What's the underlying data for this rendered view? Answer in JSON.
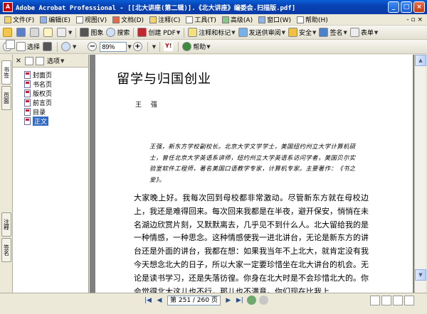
{
  "window": {
    "title": "Adobe Acrobat Professional - [[北大讲座(第二辑)].《北大讲座》编委会.扫描版.pdf]",
    "min": "_",
    "max": "□",
    "close": "×"
  },
  "menubar": {
    "items": [
      {
        "label": "文件(F)"
      },
      {
        "label": "编辑(E)"
      },
      {
        "label": "视图(V)"
      },
      {
        "label": "文档(D)"
      },
      {
        "label": "注释(C)"
      },
      {
        "label": "工具(T)"
      },
      {
        "label": "高级(A)"
      },
      {
        "label": "窗口(W)"
      },
      {
        "label": "帮助(H)"
      }
    ],
    "restore_label": "- ▫ ×"
  },
  "toolbar1": {
    "image_label": "图象",
    "search_label": "搜索",
    "create_pdf": "创建 PDF",
    "comment_markup": "注释和标记",
    "send_review": "发送供审阅",
    "security": "安全",
    "sign": "签名",
    "forms": "表单"
  },
  "toolbar2": {
    "select_label": "选择",
    "zoom_value": "89%",
    "help_label": "帮助",
    "yahoo": "Y!"
  },
  "sidebar_tabs": {
    "tab1": "书签",
    "tab2": "页面",
    "tab3": "注释",
    "tab4": "签名"
  },
  "bookmarks": {
    "options_label": "选项",
    "items": [
      {
        "label": "封面页"
      },
      {
        "label": "书名页"
      },
      {
        "label": "版权页"
      },
      {
        "label": "前言页"
      },
      {
        "label": "目录"
      },
      {
        "label": "正文"
      }
    ],
    "selected_index": 5
  },
  "document": {
    "title": "留学与归国创业",
    "author": "王 强",
    "intro": "王强，新东方学校副校长。北京大学文学学士，美国纽约州立大学计算机硕士，曾任北京大学英语系讲师，纽约州立大学英语系访问学者，美国贝尔实验室软件工程师，著名美国口语教学专家，计算机专家。主要著作：《书之爱》。",
    "body": "大家晚上好。我每次回到母校都非常激动。尽管新东方就在母校边上，我还是难得回来。每次回来我都是在半夜，避开保安，悄悄在未名湖边欣赏片刻，又默默离去，几乎见不到什么人。北大留给我的是一种情感，一种思念。这种情感使我一进北讲台，无论是新东方的讲台还是外面的讲台，我都在想：如果我当年不上北大，就肯定没有我今天想念北大的日子，所以大家一定要珍惜坐在北大讲台的机会。无论是读书学习，还是失落彷徨。你身在北大时是不会珍惜北大的。你会觉得北大这儿也不行，那儿也不满意。你们现在比我上"
  },
  "statusbar": {
    "first": "|◀",
    "prev": "◀",
    "page_indicator": "第 251 / 260 页",
    "next": "▶",
    "last": "▶|"
  }
}
